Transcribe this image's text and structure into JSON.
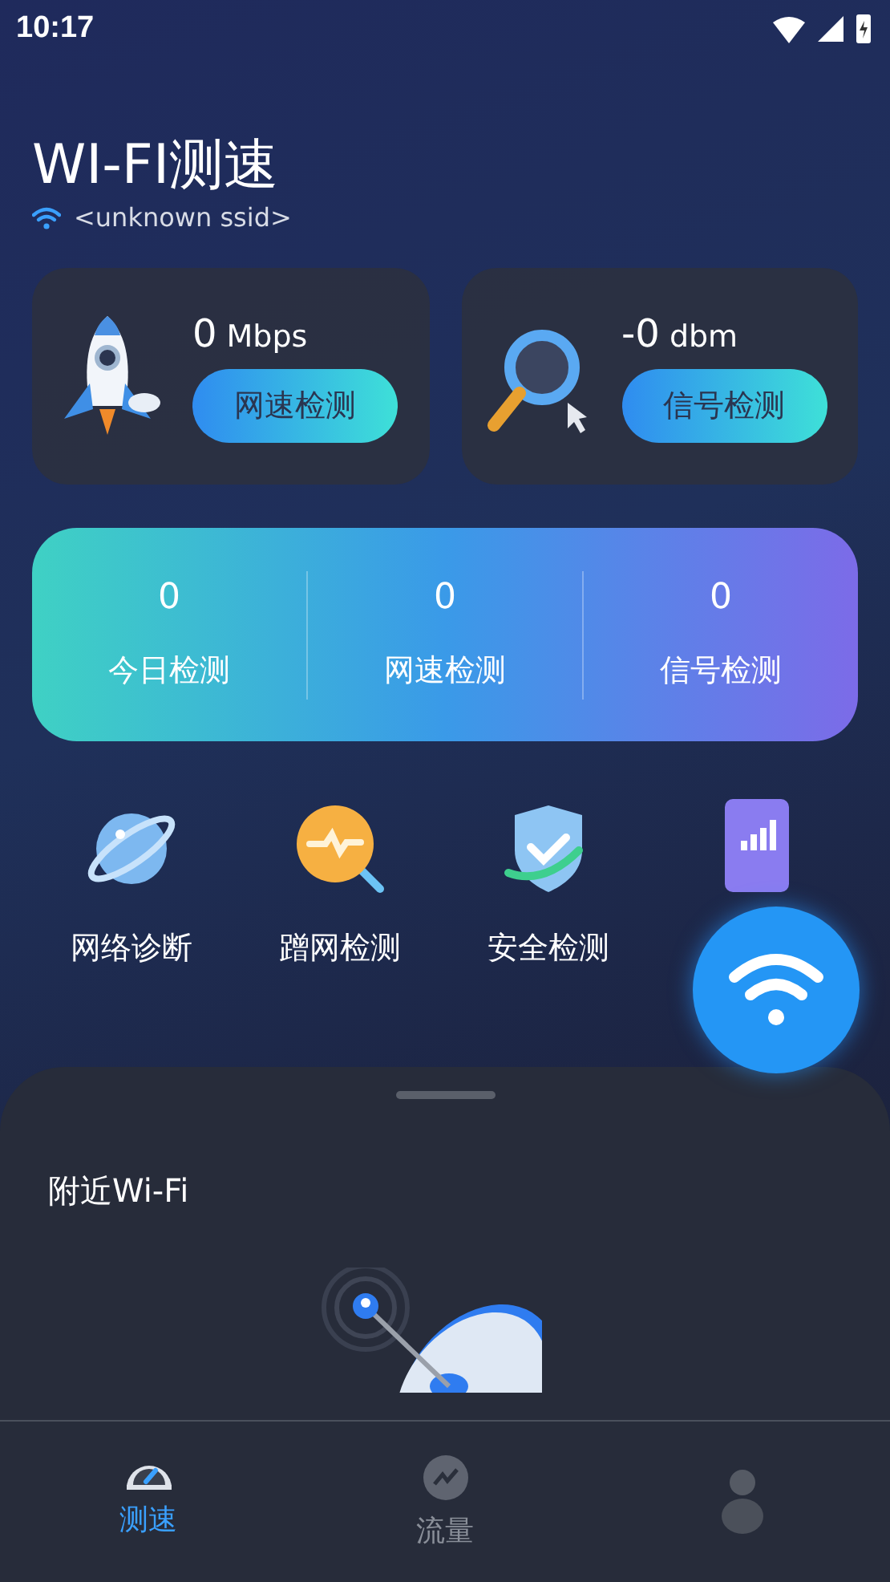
{
  "status_bar": {
    "time": "10:17"
  },
  "header": {
    "title": "WI-FI测速",
    "ssid": "<unknown ssid>"
  },
  "test_cards": [
    {
      "value": "0",
      "unit": "Mbps",
      "button": "网速检测"
    },
    {
      "value": "-0",
      "unit": "dbm",
      "button": "信号检测"
    }
  ],
  "stats": [
    {
      "count": "0",
      "label": "今日检测"
    },
    {
      "count": "0",
      "label": "网速检测"
    },
    {
      "count": "0",
      "label": "信号检测"
    }
  ],
  "tools": [
    {
      "label": "网络诊断"
    },
    {
      "label": "蹭网检测"
    },
    {
      "label": "安全检测"
    }
  ],
  "nearby": {
    "title": "附近Wi-Fi"
  },
  "nav_tabs": [
    {
      "label": "测速",
      "selected": true
    },
    {
      "label": "流量",
      "selected": false
    },
    {
      "selected": false
    }
  ]
}
